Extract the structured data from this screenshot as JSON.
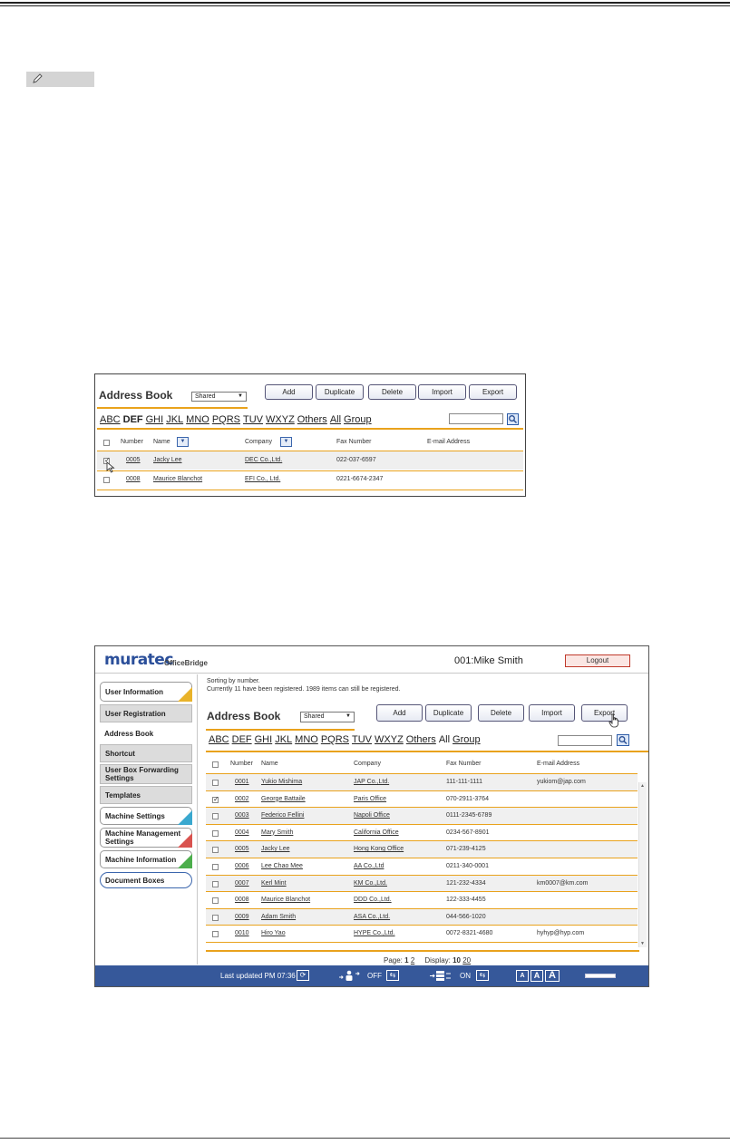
{
  "screenshot1": {
    "title": "Address Book",
    "select_value": "Shared",
    "buttons": [
      "Add",
      "Duplicate",
      "Delete",
      "Import",
      "Export"
    ],
    "alpha_index": [
      {
        "label": "ABC",
        "style": "link"
      },
      {
        "label": "DEF",
        "style": "current"
      },
      {
        "label": "GHI",
        "style": "link"
      },
      {
        "label": "JKL",
        "style": "link"
      },
      {
        "label": "MNO",
        "style": "link"
      },
      {
        "label": "PQRS",
        "style": "link"
      },
      {
        "label": "TUV",
        "style": "link"
      },
      {
        "label": "WXYZ",
        "style": "link"
      },
      {
        "label": "Others",
        "style": "link"
      },
      {
        "label": "All",
        "style": "link"
      },
      {
        "label": "Group",
        "style": "link"
      }
    ],
    "columns": [
      "Number",
      "Name",
      "Company",
      "Fax Number",
      "E-mail Address"
    ],
    "rows": [
      {
        "checked": true,
        "number": "0005",
        "name": "Jacky Lee",
        "company": "DEC Co.,Ltd.",
        "fax": "022-037-6597",
        "email": ""
      },
      {
        "checked": false,
        "number": "0008",
        "name": "Maurice Blanchot",
        "company": "EFI Co., Ltd.",
        "fax": "0221-6674-2347",
        "email": ""
      }
    ]
  },
  "screenshot2": {
    "logo_main": "muratec",
    "logo_sub": "OfficeBridge",
    "user": "001:Mike Smith",
    "logout_label": "Logout",
    "sidebar": {
      "user_information": "User Information",
      "user_registration": "User Registration",
      "address_book": "Address Book",
      "shortcut": "Shortcut",
      "user_box_forwarding": "User Box Forwarding Settings",
      "templates": "Templates",
      "machine_settings": "Machine Settings",
      "machine_management": "Machine Management Settings",
      "machine_information": "Machine Information",
      "document_boxes": "Document Boxes"
    },
    "sorting_text": "Sorting by number.",
    "registered_text": "Currently 11 have been registered. 1989 items can still be registered.",
    "title": "Address Book",
    "select_value": "Shared",
    "buttons": [
      "Add",
      "Duplicate",
      "Delete",
      "Import",
      "Export"
    ],
    "alpha_index": [
      {
        "label": "ABC",
        "style": "link"
      },
      {
        "label": "DEF",
        "style": "link"
      },
      {
        "label": "GHI",
        "style": "link"
      },
      {
        "label": "JKL",
        "style": "link"
      },
      {
        "label": "MNO",
        "style": "link"
      },
      {
        "label": "PQRS",
        "style": "link"
      },
      {
        "label": "TUV",
        "style": "link"
      },
      {
        "label": "WXYZ",
        "style": "link"
      },
      {
        "label": "Others",
        "style": "link"
      },
      {
        "label": "All",
        "style": "plain"
      },
      {
        "label": "Group",
        "style": "link"
      }
    ],
    "columns": [
      "Number",
      "Name",
      "Company",
      "Fax Number",
      "E-mail Address"
    ],
    "rows": [
      {
        "checked": false,
        "number": "0001",
        "name": "Yukio Mishima",
        "company": "JAP Co.,Ltd.",
        "fax": "111-111-1111",
        "email": "yukiom@jap.com"
      },
      {
        "checked": true,
        "number": "0002",
        "name": "George Battaile",
        "company": "Paris Office",
        "fax": "070-2911-3764",
        "email": ""
      },
      {
        "checked": false,
        "number": "0003",
        "name": "Federico Fellini",
        "company": "Napoli Office",
        "fax": "0111-2345-6789",
        "email": ""
      },
      {
        "checked": false,
        "number": "0004",
        "name": "Mary Smith",
        "company": "California Office",
        "fax": "0234-567-8901",
        "email": ""
      },
      {
        "checked": false,
        "number": "0005",
        "name": "Jacky Lee",
        "company": "Hong Kong Office",
        "fax": "071-239-4125",
        "email": ""
      },
      {
        "checked": false,
        "number": "0006",
        "name": "Lee Chao Mee",
        "company": "AA Co.,Ltd",
        "fax": "0211-340-0001",
        "email": ""
      },
      {
        "checked": false,
        "number": "0007",
        "name": "Kerl Mint",
        "company": "KM Co.,Ltd.",
        "fax": "121-232-4334",
        "email": "km0007@km.com"
      },
      {
        "checked": false,
        "number": "0008",
        "name": "Maurice Blanchot",
        "company": "DDD Co.,Ltd.",
        "fax": "122-333-4455",
        "email": ""
      },
      {
        "checked": false,
        "number": "0009",
        "name": "Adam Smith",
        "company": "ASA Co.,Ltd.",
        "fax": "044-566-1020",
        "email": ""
      },
      {
        "checked": false,
        "number": "0010",
        "name": "Hiro Yao",
        "company": "HYPE Co.,Ltd.",
        "fax": "0072-8321-4680",
        "email": "hyhyp@hyp.com"
      }
    ],
    "pager": {
      "page_label": "Page:",
      "page_current": "1",
      "page_other": "2",
      "display_label": "Display:",
      "display_current": "10",
      "display_other": "20"
    },
    "status": {
      "last_updated": "Last updated PM 07:36",
      "off_label": "OFF",
      "on_label": "ON",
      "font_sizes": [
        "A",
        "A",
        "A"
      ]
    }
  },
  "colors": {
    "accent_orange": "#e9a21c",
    "status_blue": "#36589a",
    "link_blue": "#2a4f94"
  }
}
